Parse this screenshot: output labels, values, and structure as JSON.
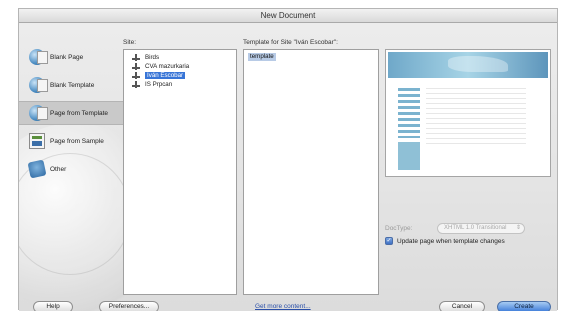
{
  "window": {
    "title": "New Document"
  },
  "categories": [
    {
      "label": "Blank Page",
      "icon": "blank-page-icon"
    },
    {
      "label": "Blank Template",
      "icon": "blank-template-icon"
    },
    {
      "label": "Page from Template",
      "icon": "page-from-template-icon"
    },
    {
      "label": "Page from Sample",
      "icon": "page-from-sample-icon"
    },
    {
      "label": "Other",
      "icon": "other-icon"
    }
  ],
  "selected_category": "Page from Template",
  "site_column": {
    "heading": "Site:",
    "items": [
      {
        "label": "Birds"
      },
      {
        "label": "CVA mazurkaria"
      },
      {
        "label": "Iván Escobar"
      },
      {
        "label": "IS Prpcan"
      }
    ],
    "selected": "Iván Escobar"
  },
  "template_column": {
    "heading": "Template for Site \"Iván Escobar\":",
    "items": [
      {
        "label": "template"
      }
    ],
    "selected": "template"
  },
  "doctype": {
    "label": "DocType:",
    "value": "XHTML 1.0 Transitional"
  },
  "update_option": {
    "label": "Update page when template changes",
    "checked": true
  },
  "buttons": {
    "help": "Help",
    "preferences": "Preferences...",
    "get_more": "Get more content...",
    "cancel": "Cancel",
    "create": "Create"
  },
  "colors": {
    "selection": "#3875d7",
    "create_button": "#3b7ad8"
  }
}
